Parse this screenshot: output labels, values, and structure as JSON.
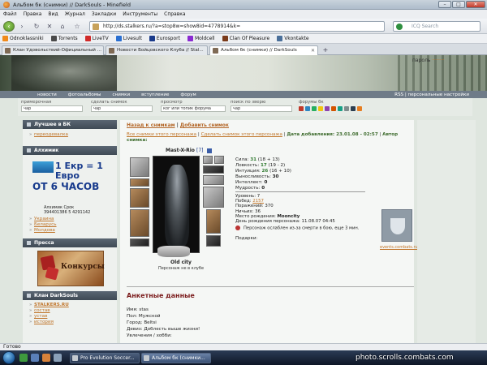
{
  "browser": {
    "title": "Альбом бк (снимки) // DarkSouls - Minefield",
    "menu": [
      "Файл",
      "Правка",
      "Вид",
      "Журнал",
      "Закладки",
      "Инструменты",
      "Справка"
    ],
    "url": "http://ds.stalkers.ru/?a=stop8w=show8id=4778914&k=",
    "search_placeholder": "ICQ Search",
    "bookmarks": [
      {
        "label": "Odnoklassniki",
        "color": "#f08a1c"
      },
      {
        "label": "Torrents",
        "color": "#4a4a4a"
      },
      {
        "label": "LiveTV",
        "color": "#d12a2a"
      },
      {
        "label": "Livesult",
        "color": "#2a6fd1"
      },
      {
        "label": "Eurosport",
        "color": "#1a3a8a"
      },
      {
        "label": "Moldcell",
        "color": "#8a2ad1"
      },
      {
        "label": "Clan Of Pleasure",
        "color": "#7a3a1a"
      },
      {
        "label": "Vkontakte",
        "color": "#4a6f9a"
      }
    ],
    "tabs": [
      {
        "label": "Клан Удовольствий-Официальный ..."
      },
      {
        "label": "Новости Бойцовского Клуба // Stal..."
      },
      {
        "label": "Альбом бк (снимки) // DarkSouls",
        "active": true
      }
    ],
    "status": "Готово"
  },
  "site": {
    "login_text": "пароль",
    "nav": [
      "новости",
      "фотоальбомы",
      "снимки",
      "вступление",
      "форум"
    ],
    "nav_right": "RSS | персональные настройки",
    "filters": [
      {
        "label": "примерочная",
        "value": "чар"
      },
      {
        "label": "сделать снимок",
        "value": "чар"
      },
      {
        "label": "просмотр",
        "value": "ког или топик форума"
      },
      {
        "label": "поиск по зверю",
        "value": "чар"
      }
    ],
    "clans_label": "форумы бк"
  },
  "sidebar": {
    "best_title": "Лучшее в БК",
    "best_items": [
      "переодевалка"
    ],
    "alchemist_title": "Алхимик",
    "ad_top": "1 Екр = 1 Евро",
    "ad_bottom": "ОТ 6 ЧАСОВ",
    "contacts_line1": "Алхимик   Срок",
    "contacts_line2": "394401386 5   4291142",
    "alchemist_links": [
      "Украина",
      "Беларусь",
      "Молдова"
    ],
    "press_title": "Пресса",
    "press_ad": "Конкурсы",
    "clan_title": "Клан DarkSouls",
    "clan_items": [
      "STALKERS.RU",
      "состав",
      "устав",
      "история"
    ]
  },
  "main": {
    "crumb_back": "Назад к снимкам",
    "crumb_add": "Добавить снимок",
    "meta_link1": "Все снимки этого персонажа",
    "meta_link2": "Сделать снимок этого персонажа",
    "meta_date": "Дата добавления: 23.01.08 - 02:57",
    "meta_author": "Автор снимка:",
    "char_name": "Mast-X-Rio",
    "char_level": "[7]",
    "city": "Old city",
    "club_note": "Персонаж не в клубе",
    "stats": [
      {
        "label": "Сила:",
        "value": "31",
        "extra": "(18 + 13)"
      },
      {
        "label": "Ловкость:",
        "value": "17",
        "extra": "(19 - 2)"
      },
      {
        "label": "Интуиция:",
        "value": "26",
        "extra": "(16 + 10)"
      },
      {
        "label": "Выносливость:",
        "value": "30",
        "extra": ""
      },
      {
        "label": "Интеллект:",
        "value": "0",
        "extra": ""
      },
      {
        "label": "Мудрость:",
        "value": "0",
        "extra": ""
      }
    ],
    "levels": [
      {
        "label": "Уровень:",
        "value": "7"
      },
      {
        "label": "Побед:",
        "value": "2157"
      },
      {
        "label": "Поражений:",
        "value": "370"
      },
      {
        "label": "Ничьих:",
        "value": "36"
      },
      {
        "label": "Место рождения:",
        "value": "Moonсity"
      },
      {
        "label": "День рождения персонажа:",
        "value": "11.08.07 04:45"
      }
    ],
    "effect": "Персонаж ослаблен из-за смерти в бою, еще 3 мин.",
    "gifts": "Подарки:",
    "events_link": "events.combats.ru",
    "section_title": "Анкетные данные",
    "profile": [
      "Имя: stas",
      "Пол: Мужской",
      "Город: Beltsi",
      "Девиз: Доблесть выше жизни!",
      "Увлечения / хобби:"
    ]
  },
  "taskbar": {
    "tasks": [
      {
        "label": "Pro Evolution Soccer..."
      },
      {
        "label": "Альбом бк (снимки...",
        "active": true
      }
    ],
    "watermark": "photo.scrolls.combats.com"
  }
}
